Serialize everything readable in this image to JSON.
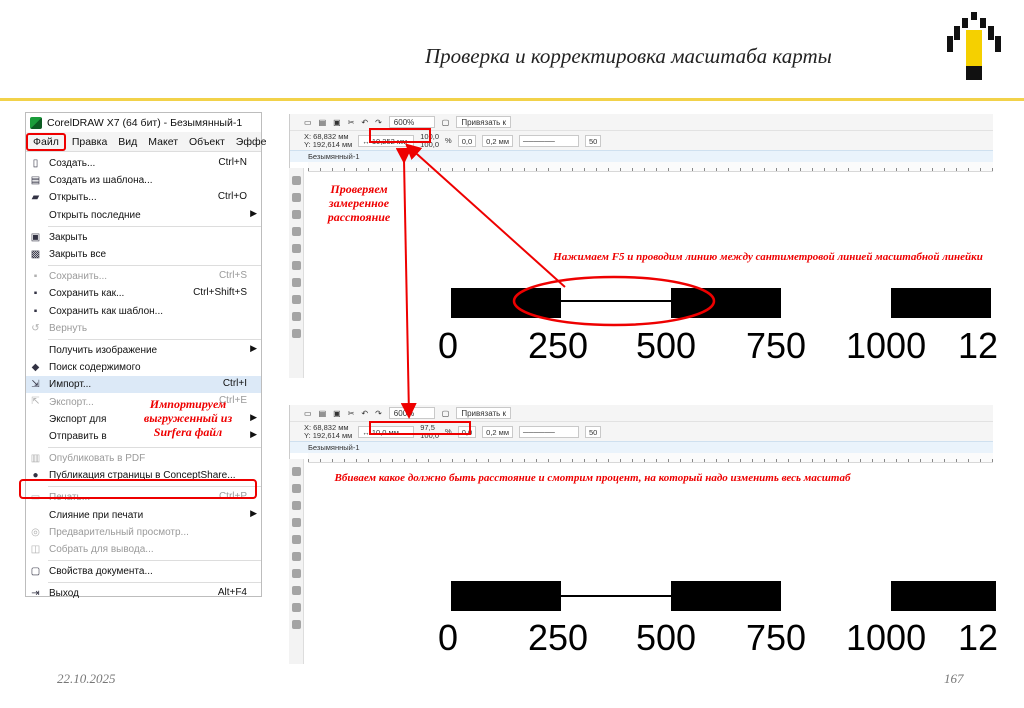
{
  "slide": {
    "title": "Проверка и корректировка масштаба карты",
    "date": "22.10.2025",
    "page": "167"
  },
  "window": {
    "title": "CorelDRAW X7 (64 бит) - Безымянный-1",
    "menubar": [
      "Файл",
      "Правка",
      "Вид",
      "Макет",
      "Объект",
      "Эффе"
    ]
  },
  "file_menu": [
    {
      "label": "Создать...",
      "shortcut": "Ctrl+N",
      "icon": "new-doc-icon",
      "disabled": false
    },
    {
      "label": "Создать из шаблона...",
      "shortcut": "",
      "icon": "template-icon",
      "disabled": false
    },
    {
      "label": "Открыть...",
      "shortcut": "Ctrl+O",
      "icon": "open-folder-icon",
      "disabled": false
    },
    {
      "label": "Открыть последние",
      "shortcut": "",
      "submenu": true,
      "disabled": false
    },
    {
      "sep": true
    },
    {
      "label": "Закрыть",
      "shortcut": "",
      "icon": "close-doc-icon",
      "disabled": false
    },
    {
      "label": "Закрыть все",
      "shortcut": "",
      "icon": "close-all-icon",
      "disabled": false
    },
    {
      "sep": true
    },
    {
      "label": "Сохранить...",
      "shortcut": "Ctrl+S",
      "icon": "save-icon",
      "disabled": true
    },
    {
      "label": "Сохранить как...",
      "shortcut": "Ctrl+Shift+S",
      "icon": "save-as-icon",
      "disabled": false
    },
    {
      "label": "Сохранить как шаблон...",
      "shortcut": "",
      "icon": "save-template-icon",
      "disabled": false
    },
    {
      "label": "Вернуть",
      "shortcut": "",
      "icon": "revert-icon",
      "disabled": true
    },
    {
      "sep": true
    },
    {
      "label": "Получить изображение",
      "shortcut": "",
      "submenu": true,
      "disabled": false
    },
    {
      "label": "Поиск содержимого",
      "shortcut": "",
      "icon": "search-content-icon",
      "disabled": false
    },
    {
      "label": "Импорт...",
      "shortcut": "Ctrl+I",
      "icon": "import-icon",
      "disabled": false,
      "highlight": true
    },
    {
      "label": "Экспорт...",
      "shortcut": "Ctrl+E",
      "icon": "export-icon",
      "disabled": true
    },
    {
      "label": "Экспорт для",
      "shortcut": "",
      "submenu": true,
      "disabled": false
    },
    {
      "label": "Отправить в",
      "shortcut": "",
      "submenu": true,
      "disabled": false
    },
    {
      "sep": true
    },
    {
      "label": "Опубликовать в PDF",
      "shortcut": "",
      "icon": "pdf-icon",
      "disabled": true
    },
    {
      "label": "Публикация страницы в ConceptShare...",
      "shortcut": "",
      "icon": "conceptshare-icon",
      "disabled": false
    },
    {
      "sep": true
    },
    {
      "label": "Печать...",
      "shortcut": "Ctrl+P",
      "icon": "print-icon",
      "disabled": true
    },
    {
      "label": "Слияние при печати",
      "shortcut": "",
      "submenu": true,
      "disabled": false
    },
    {
      "label": "Предварительный просмотр...",
      "shortcut": "",
      "icon": "preview-icon",
      "disabled": true
    },
    {
      "label": "Собрать для вывода...",
      "shortcut": "",
      "icon": "collect-icon",
      "disabled": true
    },
    {
      "sep": true
    },
    {
      "label": "Свойства документа...",
      "shortcut": "",
      "icon": "properties-icon",
      "disabled": false
    },
    {
      "sep": true
    },
    {
      "label": "Выход",
      "shortcut": "Alt+F4",
      "icon": "exit-icon",
      "disabled": false
    }
  ],
  "notes": {
    "check_distance": "Проверяем замеренное расстояние",
    "imported": "Импортируем выгруженный из Surferа файл",
    "press_f5": "Нажимаем F5 и проводим линию между сантиметровой линией масштабной линейки",
    "enter_distance": "Вбиваем какое должно быть расстояние и смотрим процент, на который надо изменить весь масштаб"
  },
  "panel_top": {
    "zoom": "600%",
    "snap": "Привязать к",
    "x": "X: 68,832 мм",
    "y": "Y: 192,614 мм",
    "length": "10,252 мм",
    "length_icon": "↔",
    "height": "0,0 мм",
    "scale1": "100,0",
    "scale2": "100,0",
    "pct": "%",
    "angle": "0,0",
    "outline": "0,2 мм",
    "nodes": "50",
    "doc_tab": "Безымянный-1"
  },
  "panel_bottom": {
    "zoom": "600%",
    "snap": "Привязать к",
    "x": "X: 68,832 мм",
    "y": "Y: 192,614 мм",
    "length": "10,0 мм",
    "length_icon": "↔",
    "height": "0,0 мм",
    "scale1": "97,5",
    "scale2": "100,0",
    "pct": "%",
    "angle": "0,0",
    "outline": "0,2 мм",
    "nodes": "50",
    "doc_tab": "Безымянный-1"
  },
  "scale_labels": [
    "0",
    "250",
    "500",
    "750",
    "1000",
    "12"
  ],
  "colors": {
    "accent_red": "#e00000",
    "gold": "#f2d24a",
    "logo_yellow": "#f5d000"
  }
}
